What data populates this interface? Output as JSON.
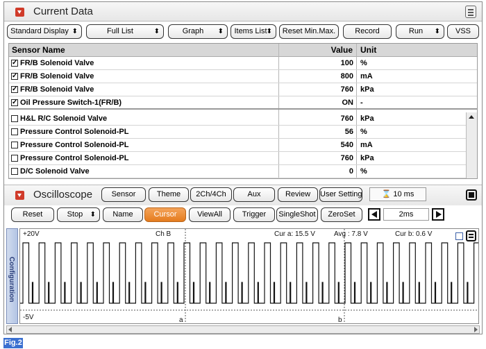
{
  "current_data": {
    "title": "Current Data",
    "toolbar": {
      "display": "Standard Display",
      "list": "Full List",
      "graph": "Graph",
      "items_list": "Items List",
      "reset_minmax": "Reset Min.Max.",
      "record": "Record",
      "run": "Run",
      "vss": "VSS"
    },
    "columns": {
      "name": "Sensor Name",
      "value": "Value",
      "unit": "Unit"
    },
    "rows": [
      {
        "checked": true,
        "name": "FR/B Solenoid Valve",
        "value": "100",
        "unit": "%"
      },
      {
        "checked": true,
        "name": "FR/B Solenoid Valve",
        "value": "800",
        "unit": "mA"
      },
      {
        "checked": true,
        "name": "FR/B Solenoid Valve",
        "value": "760",
        "unit": "kPa"
      },
      {
        "checked": true,
        "name": "Oil Pressure Switch-1(FR/B)",
        "value": "ON",
        "unit": "-"
      },
      {
        "checked": false,
        "name": "H&L R/C Solenoid Valve",
        "value": "760",
        "unit": "kPa"
      },
      {
        "checked": false,
        "name": "Pressure Control Solenoid-PL",
        "value": "56",
        "unit": "%"
      },
      {
        "checked": false,
        "name": "Pressure Control Solenoid-PL",
        "value": "540",
        "unit": "mA"
      },
      {
        "checked": false,
        "name": "Pressure Control Solenoid-PL",
        "value": "760",
        "unit": "kPa"
      },
      {
        "checked": false,
        "name": "D/C Solenoid Valve",
        "value": "0",
        "unit": "%"
      }
    ]
  },
  "oscilloscope": {
    "title": "Oscilloscope",
    "top_buttons": {
      "sensor": "Sensor",
      "theme": "Theme",
      "channels": "2Ch/4Ch",
      "aux": "Aux",
      "review": "Review",
      "user_setting": "User Setting"
    },
    "time_display": "10 ms",
    "bottom_buttons": {
      "reset": "Reset",
      "stop": "Stop",
      "name": "Name",
      "cursor": "Cursor",
      "viewall": "ViewAll",
      "trigger": "Trigger",
      "singleshot": "SingleShot",
      "zeroset": "ZeroSet"
    },
    "timebase": "2ms",
    "plot": {
      "ymax_label": "+20V",
      "ymin_label": "-5V",
      "channel": "Ch B",
      "cur_a": "Cur a: 15.5 V",
      "avg": "Avg : 7.8 V",
      "cur_b": "Cur b: 0.6 V",
      "cursor_a": "a",
      "cursor_b": "b"
    },
    "configuration": "Configuration"
  },
  "figure_label": "Fig.2"
}
